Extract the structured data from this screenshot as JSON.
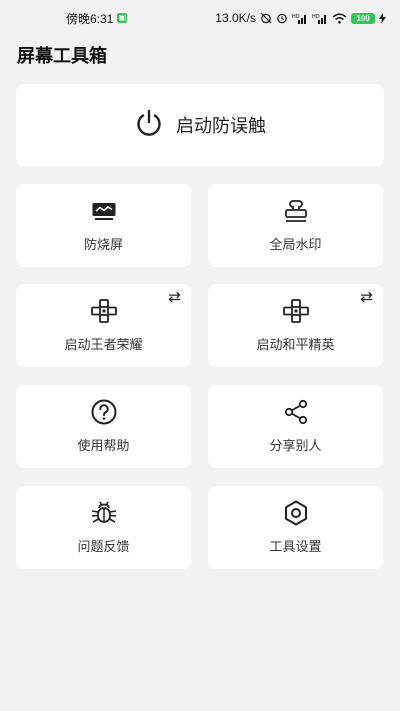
{
  "status": {
    "time": "傍晚6:31",
    "speed": "13.0K/s",
    "battery": "100",
    "icons": [
      "alarm-off-icon",
      "alarm-icon",
      "signal-hd-icon",
      "signal-hd-icon",
      "wifi-icon",
      "battery-icon",
      "charging-icon"
    ]
  },
  "app": {
    "title": "屏幕工具箱"
  },
  "hero": {
    "label": "启动防误触",
    "icon": "power-icon"
  },
  "tiles": [
    {
      "label": "防烧屏",
      "icon": "monitor-wave-icon"
    },
    {
      "label": "全局水印",
      "icon": "stamp-icon"
    },
    {
      "label": "启动王者荣耀",
      "icon": "gamepad-icon",
      "swap": "⇄"
    },
    {
      "label": "启动和平精英",
      "icon": "gamepad-icon",
      "swap": "⇄"
    },
    {
      "label": "使用帮助",
      "icon": "help-icon"
    },
    {
      "label": "分享别人",
      "icon": "share-icon"
    },
    {
      "label": "问题反馈",
      "icon": "bug-icon"
    },
    {
      "label": "工具设置",
      "icon": "settings-gear-icon"
    }
  ],
  "colors": {
    "background": "#f2f2f2",
    "card": "#ffffff",
    "battery": "#34c45a"
  }
}
